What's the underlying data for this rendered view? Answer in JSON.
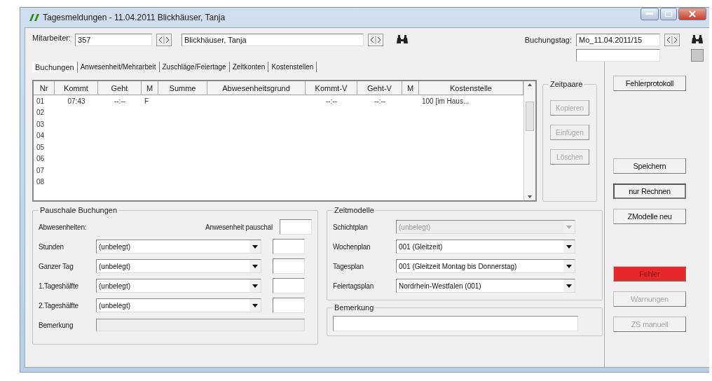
{
  "window": {
    "title": "Tagesmeldungen - 11.04.2011  Blickhäuser, Tanja"
  },
  "header": {
    "employee_label": "Mitarbeiter:",
    "employee_id": "357",
    "employee_name": "Blickhäuser, Tanja",
    "booking_day_label": "Buchungstag:",
    "booking_day": "Mo_11.04.2011/15"
  },
  "tabs": [
    {
      "label": "Buchungen",
      "selected": true
    },
    {
      "label": "Anwesenheit/Mehrarbeit",
      "selected": false
    },
    {
      "label": "Zuschläge/Feiertage",
      "selected": false
    },
    {
      "label": "Zeitkonten",
      "selected": false
    },
    {
      "label": "Kostenstellen",
      "selected": false
    }
  ],
  "table": {
    "columns": [
      "Nr",
      "Kommt",
      "Geht",
      "M",
      "Summe",
      "Abwesenheitsgrund",
      "Kommt-V",
      "Geht-V",
      "M",
      "Kostenstelle"
    ],
    "rows": [
      {
        "cells": [
          "01",
          "07:43",
          "--:--",
          "F",
          null,
          null,
          "--:--",
          "--:--",
          null,
          "100  [im Haus..."
        ]
      },
      {
        "cells": [
          "02"
        ]
      },
      {
        "cells": [
          "03"
        ]
      },
      {
        "cells": [
          "04"
        ]
      },
      {
        "cells": [
          "05"
        ]
      },
      {
        "cells": [
          "06"
        ]
      },
      {
        "cells": [
          "07"
        ]
      },
      {
        "cells": [
          "08"
        ]
      }
    ]
  },
  "zeitpaare": {
    "title": "Zeitpaare",
    "buttons": [
      {
        "label": "Kopieren",
        "disabled": true
      },
      {
        "label": "Einfügen",
        "disabled": true
      },
      {
        "label": "Löschen",
        "disabled": true
      }
    ]
  },
  "side_buttons": [
    {
      "label": "Fehlerprotokoll",
      "kind": "normal",
      "disabled": false,
      "default": false
    },
    {
      "label": "Speichern",
      "kind": "normal",
      "disabled": false,
      "default": false
    },
    {
      "label": "nur Rechnen",
      "kind": "normal",
      "disabled": false,
      "default": true
    },
    {
      "label": "ZModelle neu",
      "kind": "normal",
      "disabled": false,
      "default": false
    },
    {
      "label": "Fehler",
      "kind": "alert",
      "disabled": false,
      "default": false
    },
    {
      "label": "Warnungen",
      "kind": "normal",
      "disabled": true,
      "default": false
    },
    {
      "label": "ZS manuell",
      "kind": "normal",
      "disabled": true,
      "default": false
    }
  ],
  "pauschale": {
    "title": "Pauschale Buchungen",
    "absences_label": "Abwesenheiten:",
    "presence_label": "Anwesenheit pauschal",
    "rows": [
      {
        "label": "Stunden",
        "value": "(unbelegt)"
      },
      {
        "label": "Ganzer Tag",
        "value": "(unbelegt)"
      },
      {
        "label": "1.Tageshälfte",
        "value": "(unbelegt)"
      },
      {
        "label": "2.Tageshälfte",
        "value": "(unbelegt)"
      }
    ],
    "remark_label": "Bemerkung"
  },
  "zeitmodelle": {
    "title": "Zeitmodelle",
    "rows": [
      {
        "label": "Schichtplan",
        "value": "(unbelegt)",
        "disabled": true
      },
      {
        "label": "Wochenplan",
        "value": "001  (Gleitzeit)",
        "disabled": false
      },
      {
        "label": "Tagesplan",
        "value": "001  (Gleitzeit Montag bis Donnerstag)",
        "disabled": false
      },
      {
        "label": "Feiertagsplan",
        "value": "Nordrhein-Westfalen  (001)",
        "disabled": false
      }
    ]
  },
  "bemerkung": {
    "title": "Bemerkung"
  }
}
